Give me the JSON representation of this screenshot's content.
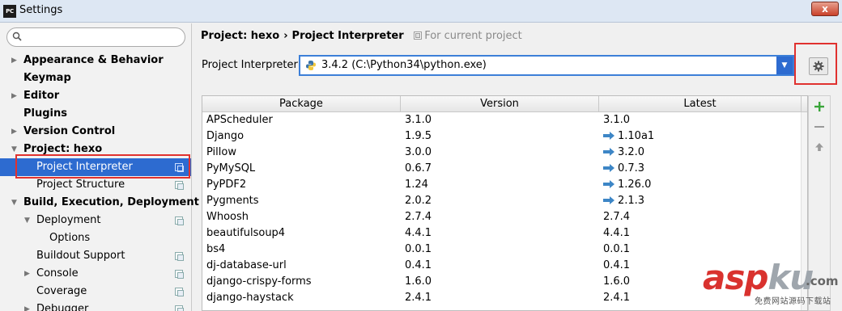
{
  "window": {
    "app_icon": "PC",
    "title": "Settings",
    "close_label": "x"
  },
  "sidebar": {
    "search_placeholder": "",
    "items": [
      {
        "label": "Appearance & Behavior",
        "bold": true,
        "arrow": "▶"
      },
      {
        "label": "Keymap",
        "bold": true,
        "arrow": ""
      },
      {
        "label": "Editor",
        "bold": true,
        "arrow": "▶"
      },
      {
        "label": "Plugins",
        "bold": true,
        "arrow": ""
      },
      {
        "label": "Version Control",
        "bold": true,
        "arrow": "▶"
      },
      {
        "label": "Project: hexo",
        "bold": true,
        "arrow": "▼"
      },
      {
        "label": "Project Interpreter",
        "bold": false,
        "arrow": "",
        "selected": true
      },
      {
        "label": "Project Structure",
        "bold": false,
        "arrow": ""
      },
      {
        "label": "Build, Execution, Deployment",
        "bold": true,
        "arrow": "▼"
      },
      {
        "label": "Deployment",
        "bold": false,
        "arrow": "▼"
      },
      {
        "label": "Options",
        "bold": false,
        "arrow": ""
      },
      {
        "label": "Buildout Support",
        "bold": false,
        "arrow": ""
      },
      {
        "label": "Console",
        "bold": false,
        "arrow": "▶"
      },
      {
        "label": "Coverage",
        "bold": false,
        "arrow": ""
      },
      {
        "label": "Debugger",
        "bold": false,
        "arrow": "▶"
      }
    ]
  },
  "breadcrumb": {
    "project": "Project: hexo",
    "separator": "›",
    "page": "Project Interpreter",
    "note": "For current project"
  },
  "interpreter": {
    "label": "Project Interpreter:",
    "value": "3.4.2 (C:\\Python34\\python.exe)"
  },
  "table": {
    "headers": [
      "Package",
      "Version",
      "Latest"
    ],
    "rows": [
      {
        "package": "APScheduler",
        "version": "3.1.0",
        "latest": "3.1.0",
        "upgrade": false
      },
      {
        "package": "Django",
        "version": "1.9.5",
        "latest": "1.10a1",
        "upgrade": true
      },
      {
        "package": "Pillow",
        "version": "3.0.0",
        "latest": "3.2.0",
        "upgrade": true
      },
      {
        "package": "PyMySQL",
        "version": "0.6.7",
        "latest": "0.7.3",
        "upgrade": true
      },
      {
        "package": "PyPDF2",
        "version": "1.24",
        "latest": "1.26.0",
        "upgrade": true
      },
      {
        "package": "Pygments",
        "version": "2.0.2",
        "latest": "2.1.3",
        "upgrade": true
      },
      {
        "package": "Whoosh",
        "version": "2.7.4",
        "latest": "2.7.4",
        "upgrade": false
      },
      {
        "package": "beautifulsoup4",
        "version": "4.4.1",
        "latest": "4.4.1",
        "upgrade": false
      },
      {
        "package": "bs4",
        "version": "0.0.1",
        "latest": "0.0.1",
        "upgrade": false
      },
      {
        "package": "dj-database-url",
        "version": "0.4.1",
        "latest": "0.4.1",
        "upgrade": false
      },
      {
        "package": "django-crispy-forms",
        "version": "1.6.0",
        "latest": "1.6.0",
        "upgrade": false
      },
      {
        "package": "django-haystack",
        "version": "2.4.1",
        "latest": "2.4.1",
        "upgrade": false
      }
    ]
  },
  "tools": {
    "add_icon": "plus-icon",
    "remove_icon": "minus-icon",
    "upgrade_icon": "up-arrow-icon"
  },
  "watermark": {
    "brand_asp": "asp",
    "brand_ku": "ku",
    "domain": ".com",
    "tagline": "免费网站源码下载站"
  },
  "colors": {
    "selection": "#2d6bd0",
    "highlight_box": "#e0312f",
    "upgrade_arrow": "#3d86c6"
  }
}
